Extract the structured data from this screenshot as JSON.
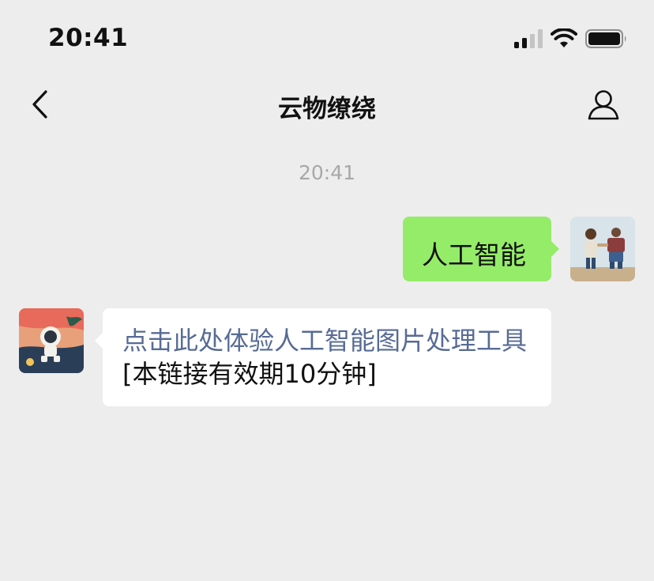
{
  "status_bar": {
    "time": "20:41",
    "icons": [
      "signal-icon",
      "wifi-icon",
      "battery-icon"
    ]
  },
  "nav": {
    "title": "云物缭绕",
    "back_icon": "chevron-left-icon",
    "profile_icon": "person-icon"
  },
  "chat": {
    "timestamp": "20:41",
    "messages": [
      {
        "sender": "self",
        "text": "人工智能"
      },
      {
        "sender": "other",
        "link_text": "点击此处体验人工智能图片处理工具",
        "suffix_text": "[本链接有效期10分钟]"
      }
    ]
  },
  "colors": {
    "background": "#ededed",
    "self_bubble": "#95ec69",
    "other_bubble": "#ffffff",
    "link": "#576b95",
    "timestamp": "#a8a8a8"
  }
}
